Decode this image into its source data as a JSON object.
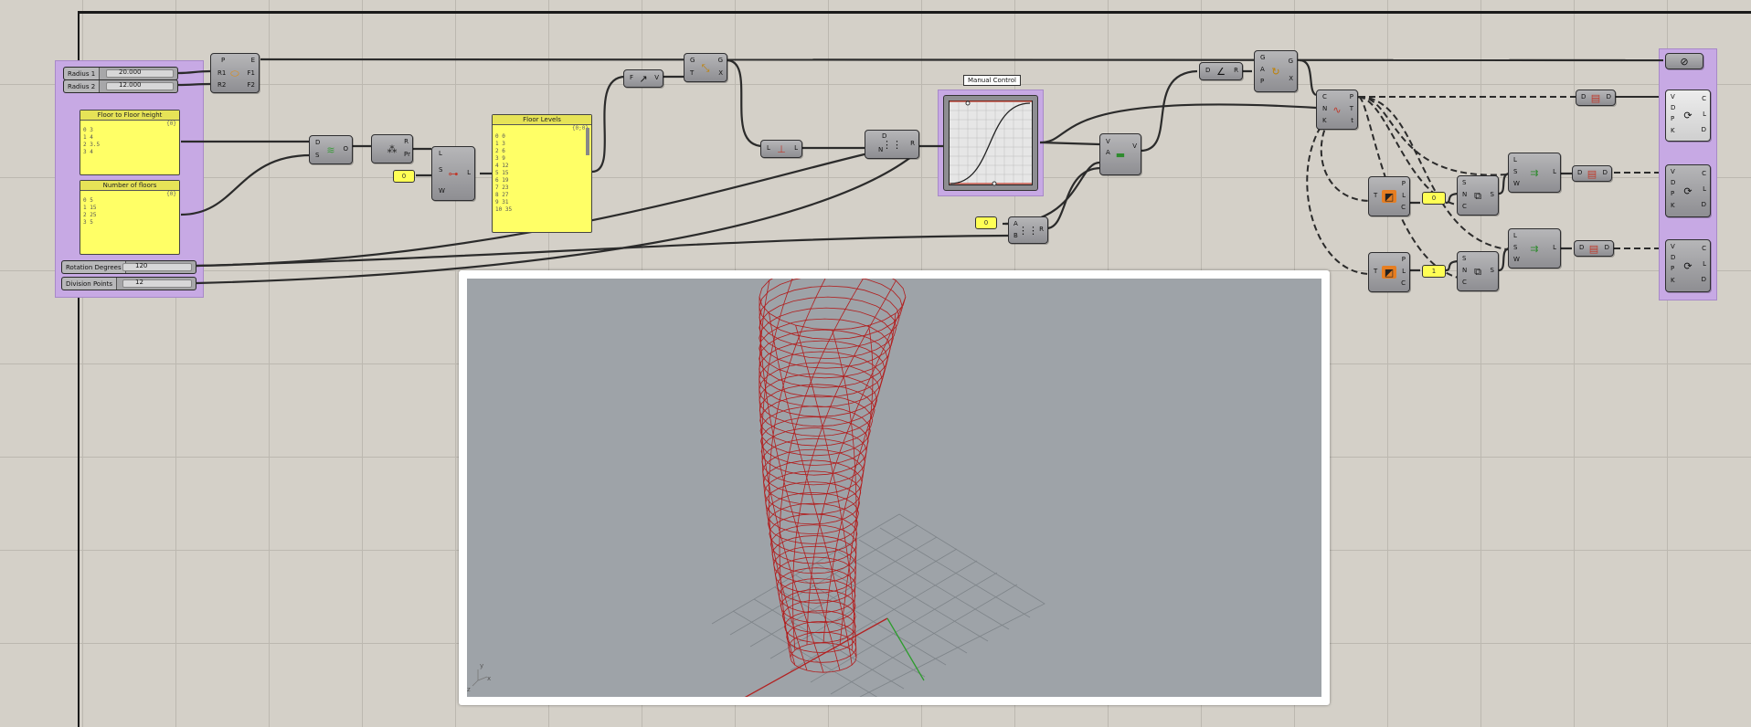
{
  "sliders": [
    {
      "label": "Radius 1",
      "value": "20.000"
    },
    {
      "label": "Radius 2",
      "value": "12.000"
    },
    {
      "label": "Rotation Degrees",
      "value": "120"
    },
    {
      "label": "Division Points",
      "value": "12"
    }
  ],
  "panels": {
    "floor_height": {
      "title": "Floor to Floor height",
      "path": "{0}",
      "rows": [
        "0  3",
        "1  4",
        "2  3.5",
        "3  4"
      ]
    },
    "num_floors": {
      "title": "Number of floors",
      "path": "{0}",
      "rows": [
        "0  5",
        "1  15",
        "2  25",
        "3  5"
      ]
    },
    "floor_levels": {
      "title": "Floor Levels",
      "path": "{0;0}",
      "rows": [
        "0  0",
        "1  3",
        "2  6",
        "3  9",
        "4  12",
        "5  15",
        "6  19",
        "7  23",
        "8  27",
        "9  31",
        "10  35"
      ]
    }
  },
  "numbers": {
    "n1": "0",
    "n2": "0",
    "n3": "0",
    "n4": "1"
  },
  "graph_mapper": {
    "tooltip": "Manual Control"
  },
  "components": {
    "ellipse": {
      "icon": "ellipse-icon",
      "inputs": [
        "P",
        "R1",
        "R2"
      ],
      "outputs": [
        "E",
        "F1",
        "F2"
      ]
    },
    "mass_addition": {
      "icon": "mass-addition-icon",
      "inputs": [
        "D",
        "S"
      ],
      "outputs": [
        "O"
      ]
    },
    "series": {
      "icon": "series-icon",
      "inputs": [
        "R",
        "Pr"
      ],
      "outputs": [
        "R"
      ]
    },
    "shift_list": {
      "icon": "shift-list-icon",
      "inputs": [
        "L",
        "S",
        "W"
      ],
      "outputs": [
        "L"
      ]
    },
    "unit_z": {
      "icon": "unit-z-icon",
      "inputs": [
        "F"
      ],
      "outputs": [
        "V"
      ]
    },
    "move": {
      "icon": "move-icon",
      "inputs": [
        "G",
        "T"
      ],
      "outputs": [
        "G",
        "X"
      ]
    },
    "list_length": {
      "icon": "list-length-icon",
      "inputs": [
        "L"
      ],
      "outputs": [
        "L"
      ]
    },
    "range": {
      "icon": "range-icon",
      "inputs": [
        "D",
        "N"
      ],
      "outputs": [
        "R"
      ]
    },
    "amplitude": {
      "icon": "amplitude-icon",
      "inputs": [
        "V",
        "A"
      ],
      "outputs": [
        "V"
      ]
    },
    "radians": {
      "icon": "radians-icon",
      "inputs": [
        "D"
      ],
      "outputs": [
        "R"
      ]
    },
    "rotate": {
      "icon": "rotate-icon",
      "inputs": [
        "G",
        "A",
        "P"
      ],
      "outputs": [
        "G",
        "X"
      ]
    },
    "divide_curve": {
      "icon": "divide-curve-icon",
      "inputs": [
        "C",
        "N",
        "K"
      ],
      "outputs": [
        "P",
        "T",
        "t"
      ]
    },
    "multiply": {
      "icon": "multiply-icon",
      "inputs": [
        "A",
        "B"
      ],
      "outputs": [
        "R"
      ]
    },
    "plane_a": {
      "icon": "plane-icon",
      "inputs": [
        "T"
      ],
      "outputs": [
        "P",
        "L",
        "C"
      ]
    },
    "plane_b": {
      "icon": "plane-icon",
      "inputs": [
        "T"
      ],
      "outputs": [
        "P",
        "L",
        "C"
      ]
    },
    "evaluate_a": {
      "icon": "evaluate-icon",
      "inputs": [
        "S",
        "N",
        "C"
      ],
      "outputs": [
        "S"
      ]
    },
    "evaluate_b": {
      "icon": "evaluate-icon",
      "inputs": [
        "S",
        "N",
        "C"
      ],
      "outputs": [
        "S"
      ]
    },
    "shift_a": {
      "icon": "shift-icon",
      "inputs": [
        "L",
        "S",
        "W"
      ],
      "outputs": [
        "L"
      ]
    },
    "shift_b": {
      "icon": "shift-icon",
      "inputs": [
        "L",
        "S",
        "W"
      ],
      "outputs": [
        "L"
      ]
    },
    "flip_a": {
      "icon": "flip-matrix-icon",
      "inputs": [
        "D"
      ],
      "outputs": [
        "D"
      ]
    },
    "flip_b": {
      "icon": "flip-matrix-icon",
      "inputs": [
        "D"
      ],
      "outputs": [
        "D"
      ]
    },
    "flip_c": {
      "icon": "flip-matrix-icon",
      "inputs": [
        "D"
      ],
      "outputs": [
        "D"
      ]
    },
    "pipe": {
      "icon": "preview-icon",
      "inputs": [],
      "outputs": []
    },
    "interp_a": {
      "icon": "interpolate-curve-icon",
      "inputs": [
        "V",
        "D",
        "P",
        "K"
      ],
      "outputs": [
        "C",
        "L",
        "D"
      ]
    },
    "interp_b": {
      "icon": "interpolate-curve-icon",
      "inputs": [
        "V",
        "D",
        "P",
        "K"
      ],
      "outputs": [
        "C",
        "L",
        "D"
      ]
    },
    "interp_c": {
      "icon": "interpolate-curve-icon",
      "inputs": [
        "V",
        "D",
        "P",
        "K"
      ],
      "outputs": [
        "C",
        "L",
        "D"
      ]
    }
  },
  "viewport": {
    "axis_label": "x",
    "axis_label_y": "y",
    "axis_label_z": "z"
  }
}
